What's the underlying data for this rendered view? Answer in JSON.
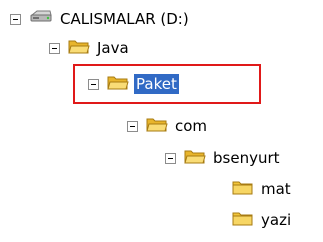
{
  "tree": {
    "drive": {
      "label": "CALISMALAR (D:)"
    },
    "items": [
      {
        "label": "Java"
      },
      {
        "label": "Paket",
        "selected": true
      },
      {
        "label": "com"
      },
      {
        "label": "bsenyurt"
      },
      {
        "label": "mat"
      },
      {
        "label": "yazi"
      }
    ]
  },
  "colors": {
    "selection": "#316ac5",
    "highlight_border": "#e01919",
    "folder": "#f2c53a"
  }
}
